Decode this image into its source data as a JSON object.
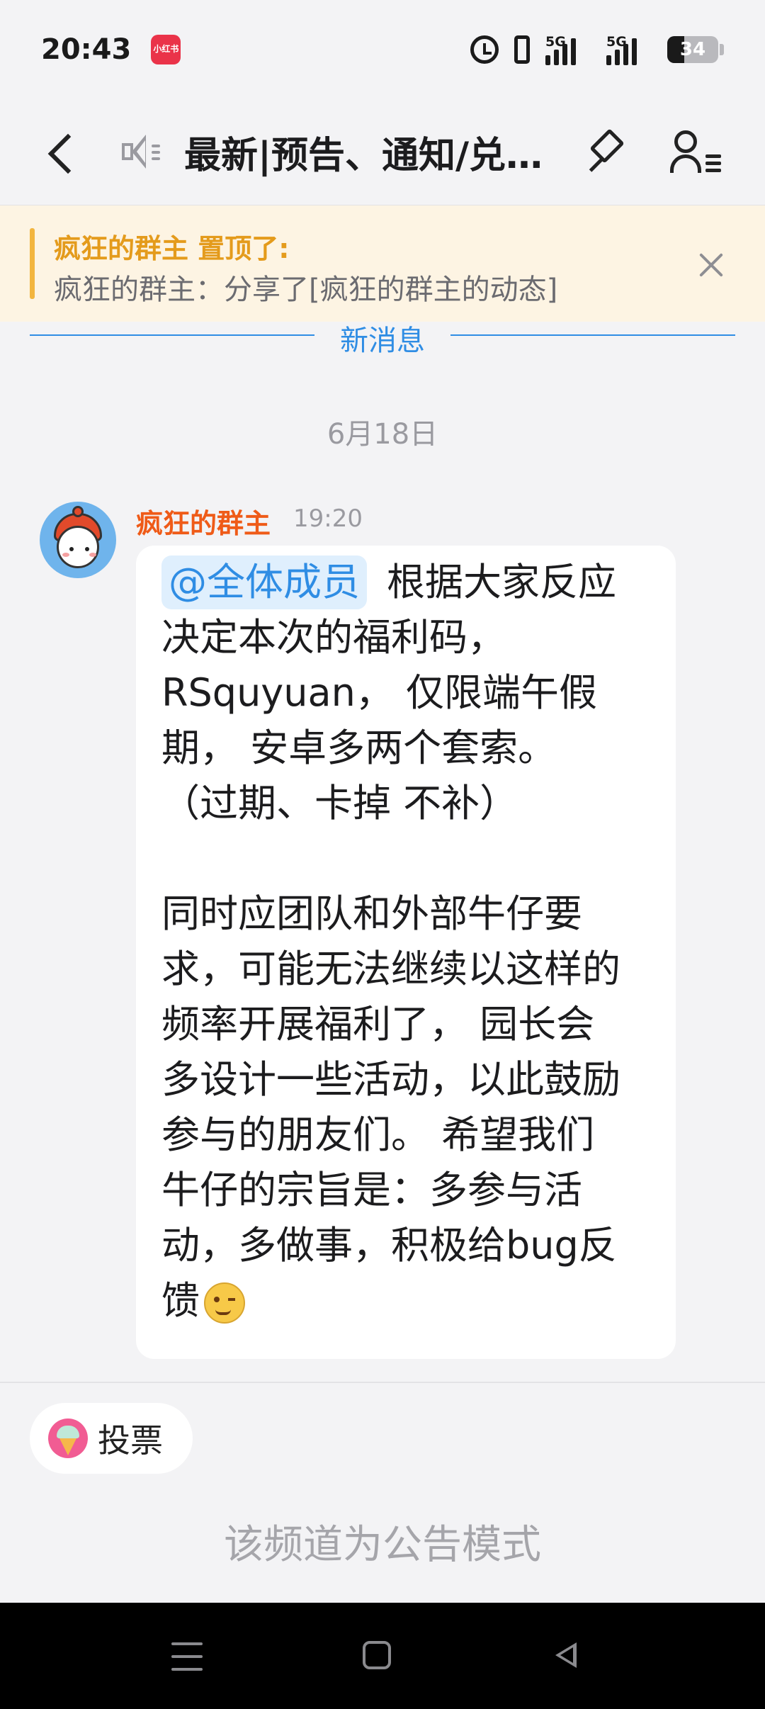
{
  "status_bar": {
    "time": "20:43",
    "app_badge_text": "小红书",
    "network_1": "5G",
    "network_2": "5G",
    "battery_level": 34,
    "battery_text": "34",
    "icons": [
      "alarm-icon",
      "vibrate-icon",
      "signal-icon",
      "signal-icon",
      "battery-icon"
    ]
  },
  "header": {
    "title": "最新|预告、通知/兑…",
    "icons": [
      "back-icon",
      "speaker-icon",
      "pin-icon",
      "member-list-icon"
    ]
  },
  "pinned": {
    "label": "疯狂的群主 置顶了:",
    "content": "疯狂的群主：分享了[疯狂的群主的动态]",
    "accent_color": "#f2b53f"
  },
  "divider": {
    "label": "新消息"
  },
  "date_separator": "6月18日",
  "message": {
    "sender": "疯狂的群主",
    "time": "19:20",
    "mention": "@全体成员",
    "lines": [
      "根据大家反应",
      "决定本次的福利码，",
      "RSquyuan， 仅限端午假",
      "期， 安卓多两个套索。",
      "（过期、卡掉 不补）",
      "",
      "同时应团队和外部牛仔要",
      "求，可能无法继续以这样的",
      "频率开展福利了，    园长会",
      "多设计一些活动，以此鼓励",
      "参与的朋友们。    希望我们",
      "牛仔的宗旨是：多参与活",
      "动，多做事，积极给bug反",
      "馈"
    ],
    "sender_color": "#ef5b18",
    "mention_color": "#2f8de4"
  },
  "footer": {
    "vote_label": "投票",
    "mode_note": "该频道为公告模式"
  },
  "navbar": {
    "icons": [
      "menu-icon",
      "home-icon",
      "back-triangle-icon"
    ]
  }
}
